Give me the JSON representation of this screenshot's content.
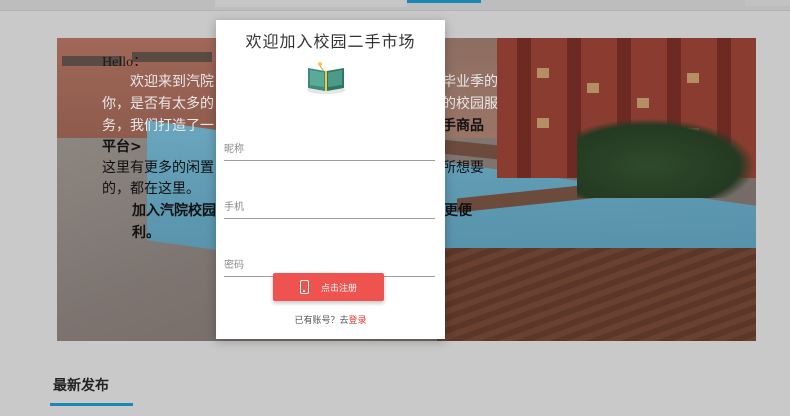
{
  "hero": {
    "hello": "Hello：",
    "p1_start": "欢迎来到汽院",
    "p1_end": "毕业季的",
    "line2_start": "你，是否有太多的",
    "line2_end": "的校园服",
    "line3_start": "务，我们打造了一",
    "line3_end": "手商品",
    "line4": "平台>",
    "p2_a": "这里有更多的闲置",
    "p2_a_end": "所想要",
    "p2_b": "的，都在这里。",
    "p3_a": "加入汽院校园",
    "p3_a_end": "立更便",
    "p3_b": "利。"
  },
  "latest": {
    "title": "最新发布"
  },
  "modal": {
    "title": "欢迎加入校园二手市场",
    "book_icon": "book-icon",
    "fields": {
      "nickname_placeholder": "昵称",
      "phone_placeholder": "手机",
      "password_placeholder": "密码"
    },
    "register_label": "点击注册",
    "register_icon": "phone-icon",
    "login_prompt": "已有账号？去",
    "login_link": "登录"
  },
  "colors": {
    "accent": "#1a88b5",
    "register": "#ef5350",
    "login_link": "#e53935"
  }
}
